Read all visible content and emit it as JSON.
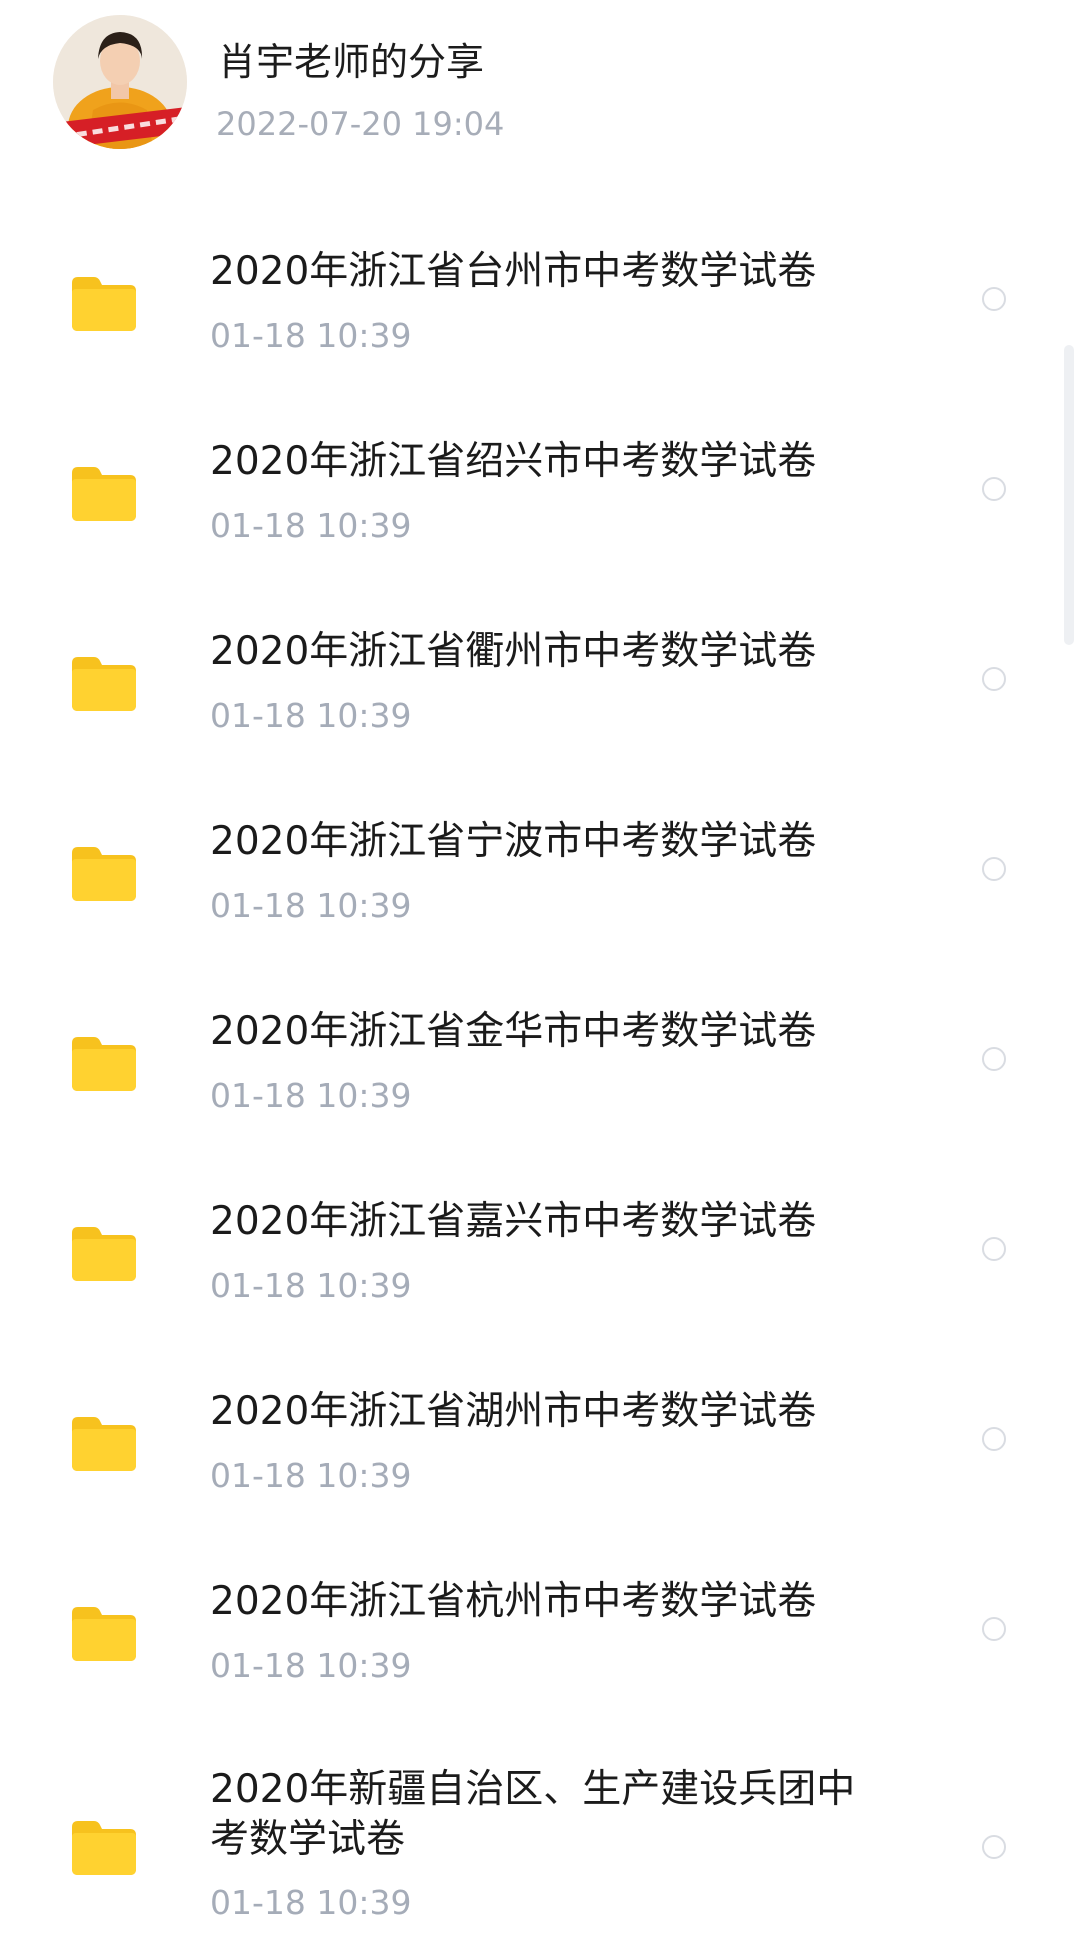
{
  "share": {
    "title": "肖宇老师的分享",
    "time": "2022-07-20  19:04",
    "avatar_icon": "teacher-avatar-photo"
  },
  "colors": {
    "folder": "#FFD230",
    "folder_tab": "#F7C21E",
    "secondary_text": "#A5ACB8",
    "primary_text": "#1B1B1B"
  },
  "files": [
    {
      "name": "2020年浙江省台州市中考数学试卷",
      "date": "01-18  10:39",
      "icon": "folder-icon"
    },
    {
      "name": "2020年浙江省绍兴市中考数学试卷",
      "date": "01-18  10:39",
      "icon": "folder-icon"
    },
    {
      "name": "2020年浙江省衢州市中考数学试卷",
      "date": "01-18  10:39",
      "icon": "folder-icon"
    },
    {
      "name": "2020年浙江省宁波市中考数学试卷",
      "date": "01-18  10:39",
      "icon": "folder-icon"
    },
    {
      "name": "2020年浙江省金华市中考数学试卷",
      "date": "01-18  10:39",
      "icon": "folder-icon"
    },
    {
      "name": "2020年浙江省嘉兴市中考数学试卷",
      "date": "01-18  10:39",
      "icon": "folder-icon"
    },
    {
      "name": "2020年浙江省湖州市中考数学试卷",
      "date": "01-18  10:39",
      "icon": "folder-icon"
    },
    {
      "name": "2020年浙江省杭州市中考数学试卷",
      "date": "01-18  10:39",
      "icon": "folder-icon"
    },
    {
      "name": "2020年新疆自治区、生产建设兵团中考数学试卷",
      "date": "01-18  10:39",
      "icon": "folder-icon"
    }
  ]
}
